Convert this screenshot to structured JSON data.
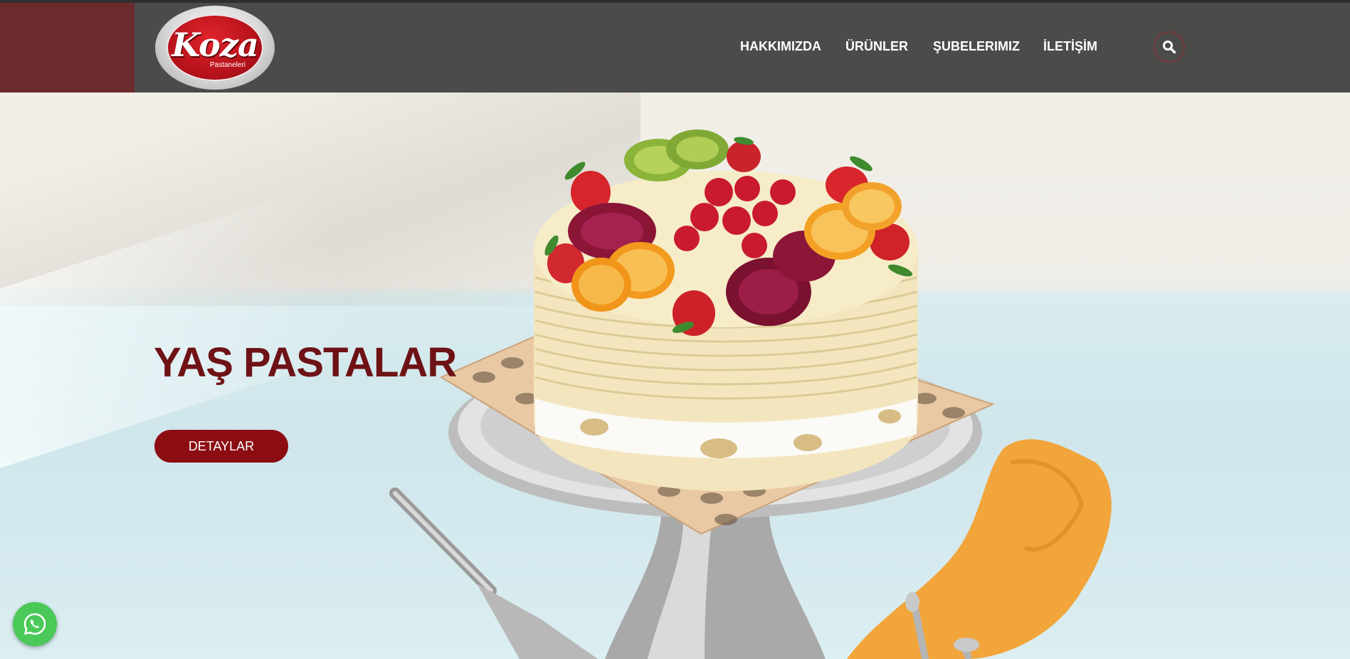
{
  "brand": {
    "name": "Koza",
    "subtitle": "Pastaneleri"
  },
  "nav": {
    "items": [
      {
        "label": "HAKKIMIZDA"
      },
      {
        "label": "ÜRÜNLER"
      },
      {
        "label": "ŞUBELERIMIZ"
      },
      {
        "label": "İLETİŞİM"
      }
    ],
    "search_icon": "search-icon"
  },
  "hero": {
    "title": "YAŞ PASTALAR",
    "button_label": "DETAYLAR"
  },
  "floating": {
    "whatsapp_icon": "whatsapp-icon"
  },
  "colors": {
    "header_bg": "#4b4b4a",
    "header_accent": "#6b2b2c",
    "brand_red": "#8b0d12",
    "title_red": "#6e1216",
    "whatsapp_green": "#4ac959"
  }
}
